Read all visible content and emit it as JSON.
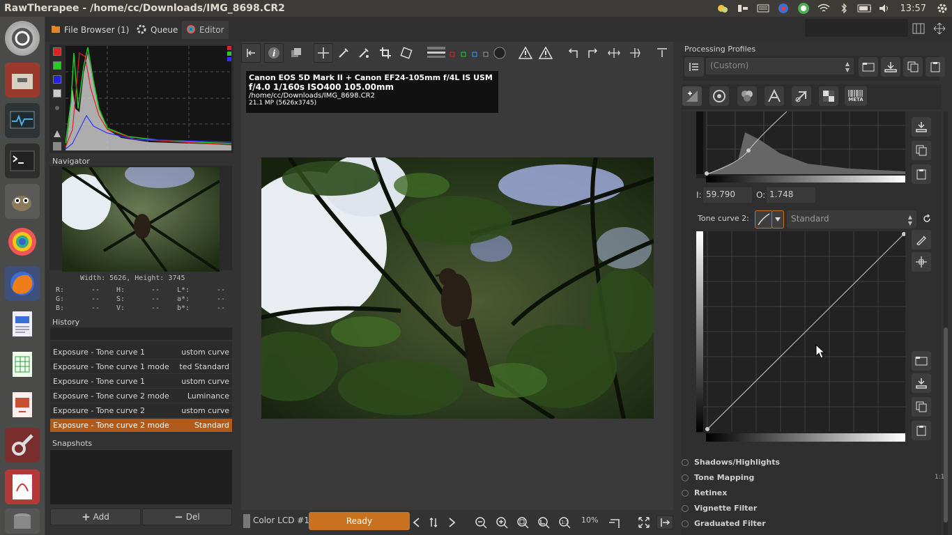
{
  "window": {
    "title": "RawTherapee  - /home/cc/Downloads/IMG_8698.CR2",
    "clock": "13:57"
  },
  "tabs": [
    {
      "label": "File Browser (1)"
    },
    {
      "label": "Queue"
    },
    {
      "label": "Editor"
    }
  ],
  "exif": {
    "camera": "Canon EOS 5D Mark II + Canon EF24-105mm f/4L IS USM",
    "exposure": "f/4.0  1/160s  ISO400  105.00mm",
    "path": "/home/cc/Downloads/IMG_8698.CR2",
    "megapixels": "21.1 MP (5626x3745)"
  },
  "navigator": {
    "title": "Navigator",
    "dimensions": "Width: 5626, Height: 3745",
    "readout": {
      "r": "R:",
      "g": "G:",
      "b": "B:",
      "h": "H:",
      "s": "S:",
      "v": "V:",
      "l": "L*:",
      "a": "a*:",
      "bstar": "b*:",
      "empty": "--"
    }
  },
  "history": {
    "title": "History",
    "items": [
      {
        "name": "Exposure - Tone curve 1",
        "value": "ustom curve"
      },
      {
        "name": "Exposure - Tone curve 1 mode",
        "value": "ted Standard"
      },
      {
        "name": "Exposure - Tone curve 1",
        "value": "ustom curve"
      },
      {
        "name": "Exposure - Tone curve 2 mode",
        "value": "Luminance"
      },
      {
        "name": "Exposure - Tone curve 2",
        "value": "ustom curve"
      },
      {
        "name": "Exposure - Tone curve 2 mode",
        "value": "Standard"
      }
    ]
  },
  "snapshots": {
    "title": "Snapshots",
    "add": "Add",
    "del": "Del"
  },
  "profiles": {
    "title": "Processing Profiles",
    "selected": "(Custom)"
  },
  "curve1": {
    "i_label": "I:",
    "i_value": "59.790",
    "o_label": "O:",
    "o_value": "1.748"
  },
  "curve2": {
    "label": "Tone curve 2:",
    "mode": "Standard"
  },
  "sections": [
    "Shadows/Highlights",
    "Tone Mapping",
    "Retinex",
    "Vignette Filter",
    "Graduated Filter"
  ],
  "section_extra": "1:1",
  "meta_tab": "META",
  "statusbar": {
    "profile": "Color LCD #1",
    "status": "Ready",
    "zoom": "10%"
  },
  "colors": {
    "accent": "#c8721f",
    "selected_row": "#b05b1b"
  }
}
